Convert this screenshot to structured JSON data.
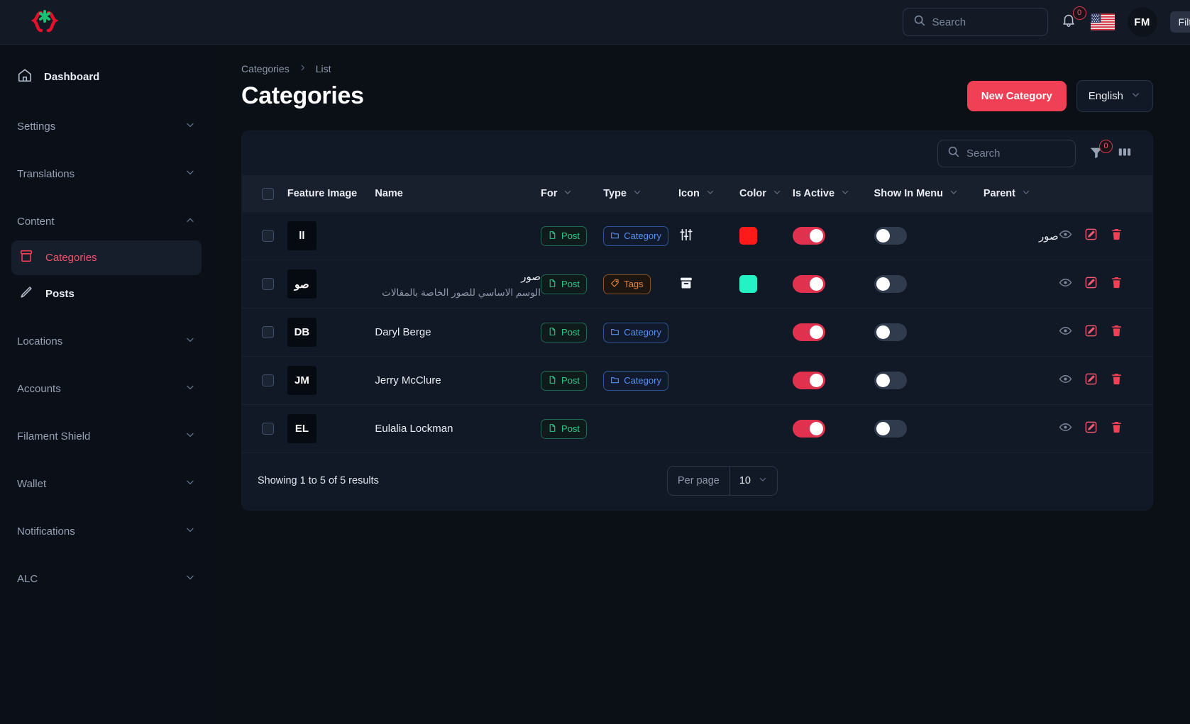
{
  "brand": {
    "logo_icon": "braces-asterisk-logo",
    "accent": "#ef4056",
    "logo_green": "#19c37d"
  },
  "topbar": {
    "search": {
      "placeholder": "Search",
      "value": "",
      "icon": "search-icon"
    },
    "bell": {
      "icon": "bell-icon",
      "badge": "0"
    },
    "flag": {
      "icon": "us-flag-icon"
    },
    "avatar": {
      "initials": "FM"
    },
    "tooltip": {
      "text": "Filte"
    }
  },
  "sidebar": {
    "dashboard": {
      "label": "Dashboard",
      "icon": "home-icon"
    },
    "groups": [
      {
        "label": "Settings",
        "icon": "chevron-down-icon",
        "open": false
      },
      {
        "label": "Translations",
        "icon": "chevron-down-icon",
        "open": false
      },
      {
        "label": "Content",
        "icon": "chevron-up-icon",
        "open": true
      },
      {
        "label": "Locations",
        "icon": "chevron-down-icon",
        "open": false
      },
      {
        "label": "Accounts",
        "icon": "chevron-down-icon",
        "open": false
      },
      {
        "label": "Filament Shield",
        "icon": "chevron-down-icon",
        "open": false
      },
      {
        "label": "Wallet",
        "icon": "chevron-down-icon",
        "open": false
      },
      {
        "label": "Notifications",
        "icon": "chevron-down-icon",
        "open": false
      },
      {
        "label": "ALC",
        "icon": "chevron-down-icon",
        "open": false
      }
    ],
    "content_items": [
      {
        "label": "Categories",
        "icon": "archive-icon",
        "active": true
      },
      {
        "label": "Posts",
        "icon": "pencil-icon",
        "active": false
      }
    ]
  },
  "header": {
    "breadcrumb": [
      "Categories",
      "List"
    ],
    "breadcrumb_separator": "›",
    "title": "Categories",
    "new_button": "New Category",
    "language": "English"
  },
  "table_toolbar": {
    "search": {
      "placeholder": "Search",
      "value": "",
      "icon": "search-icon"
    },
    "filter": {
      "icon": "funnel-icon",
      "badge": "0"
    },
    "columns": {
      "icon": "columns-icon"
    }
  },
  "table": {
    "columns": [
      {
        "key": "check",
        "label": "",
        "sortable": false
      },
      {
        "key": "image",
        "label": "Feature Image",
        "sortable": false
      },
      {
        "key": "name",
        "label": "Name",
        "sortable": false
      },
      {
        "key": "for",
        "label": "For",
        "sortable": true
      },
      {
        "key": "type",
        "label": "Type",
        "sortable": true
      },
      {
        "key": "icon",
        "label": "Icon",
        "sortable": true
      },
      {
        "key": "color",
        "label": "Color",
        "sortable": true
      },
      {
        "key": "active",
        "label": "Is Active",
        "sortable": true
      },
      {
        "key": "menu",
        "label": "Show In Menu",
        "sortable": true
      },
      {
        "key": "parent",
        "label": "Parent",
        "sortable": true
      },
      {
        "key": "actions",
        "label": "",
        "sortable": false
      }
    ],
    "rows": [
      {
        "thumb": "ll",
        "name": "",
        "name_sub": "",
        "for": "Post",
        "type": "Category",
        "type_style": "blue",
        "icon": "sliders-icon",
        "color": "#ff1a1a",
        "is_active": true,
        "show_in_menu": false,
        "parent": "صور"
      },
      {
        "thumb": "صو",
        "name": "صور",
        "name_sub": "الوسم الاساسي للصور الخاصة بالمقالات",
        "for": "Post",
        "type": "Tags",
        "type_style": "orange",
        "icon": "archive-box-icon",
        "color": "#25f2c4",
        "is_active": true,
        "show_in_menu": false,
        "parent": ""
      },
      {
        "thumb": "DB",
        "name": "Daryl Berge",
        "name_sub": "",
        "for": "Post",
        "type": "Category",
        "type_style": "blue",
        "icon": "",
        "color": "",
        "is_active": true,
        "show_in_menu": false,
        "parent": ""
      },
      {
        "thumb": "JM",
        "name": "Jerry McClure",
        "name_sub": "",
        "for": "Post",
        "type": "Category",
        "type_style": "blue",
        "icon": "",
        "color": "",
        "is_active": true,
        "show_in_menu": false,
        "parent": ""
      },
      {
        "thumb": "EL",
        "name": "Eulalia Lockman",
        "name_sub": "",
        "for": "Post",
        "type": "",
        "type_style": "",
        "icon": "",
        "color": "",
        "is_active": true,
        "show_in_menu": false,
        "parent": ""
      }
    ],
    "row_actions": [
      {
        "name": "view-icon",
        "color": "#7b8699"
      },
      {
        "name": "edit-icon",
        "color": "#ef5a70"
      },
      {
        "name": "delete-icon",
        "color": "#ef4056"
      }
    ]
  },
  "footer": {
    "results": "Showing 1 to 5 of 5 results",
    "per_page_label": "Per page",
    "per_page_value": "10"
  }
}
